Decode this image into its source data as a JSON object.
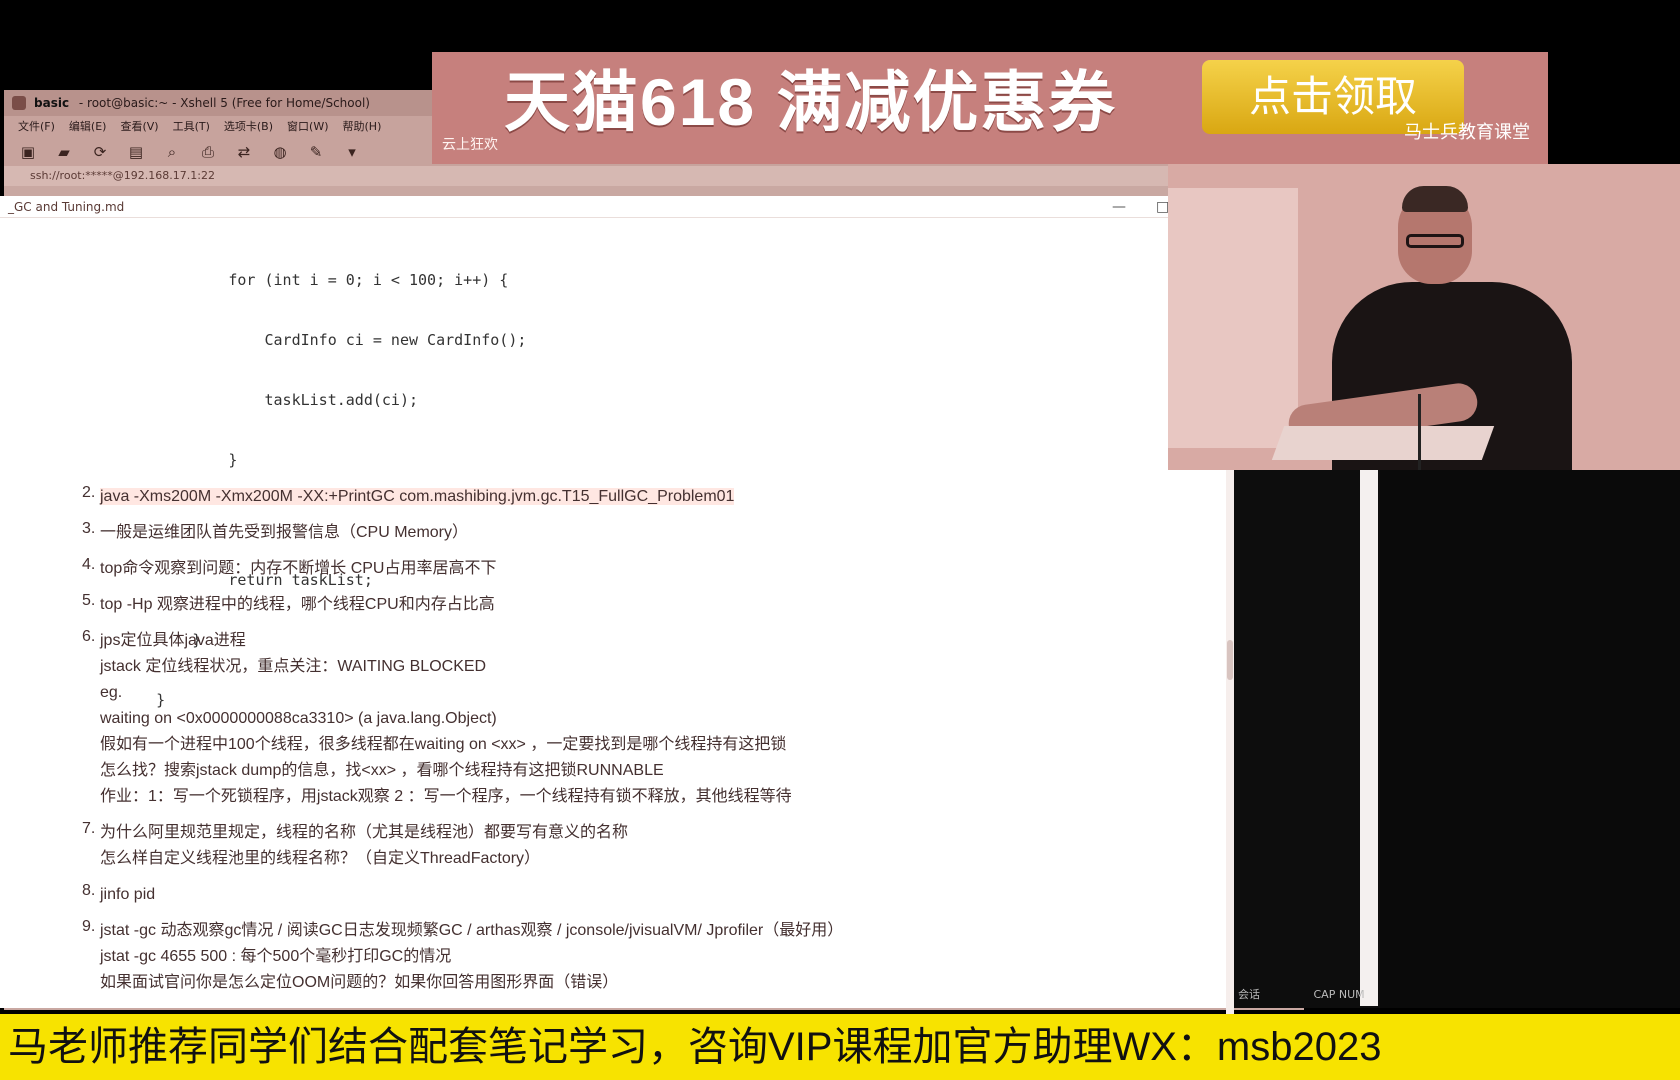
{
  "xshell": {
    "title_bold": "basic",
    "title_rest": "- root@basic:~ - Xshell 5 (Free for Home/School)",
    "menu": [
      "文件(F)",
      "编辑(E)",
      "查看(V)",
      "工具(T)",
      "选项卡(B)",
      "窗口(W)",
      "帮助(H)"
    ],
    "address": "ssh://root:*****@192.168.17.1:22",
    "toolbar_icons": [
      "new-session-icon",
      "open-folder-icon",
      "reconnect-icon",
      "properties-icon",
      "find-icon",
      "print-icon",
      "transfer-icon",
      "globe-icon",
      "script-icon",
      "more-icon"
    ]
  },
  "editor": {
    "file_title": "_GC and Tuning.md",
    "minimize": "—",
    "maximize": "□",
    "code_lines": [
      "            for (int i = 0; i < 100; i++) {",
      "                CardInfo ci = new CardInfo();",
      "                taskList.add(ci);",
      "            }",
      "",
      "            return taskList;",
      "        }",
      "    }"
    ],
    "items": [
      {
        "num": "2.",
        "lines": [
          "java -Xms200M -Xmx200M -XX:+PrintGC com.mashibing.jvm.gc.T15_FullGC_Problem01"
        ]
      },
      {
        "num": "3.",
        "lines": [
          "一般是运维团队首先受到报警信息（CPU Memory）"
        ]
      },
      {
        "num": "4.",
        "lines": [
          "top命令观察到问题：内存不断增长 CPU占用率居高不下"
        ]
      },
      {
        "num": "5.",
        "lines": [
          "top -Hp 观察进程中的线程，哪个线程CPU和内存占比高"
        ]
      },
      {
        "num": "6.",
        "lines": [
          "jps定位具体java进程",
          "jstack 定位线程状况，重点关注：WAITING BLOCKED",
          "eg.",
          "waiting on <0x0000000088ca3310> (a java.lang.Object)",
          "假如有一个进程中100个线程，很多线程都在waiting on <xx> ，一定要找到是哪个线程持有这把锁",
          "怎么找？搜索jstack dump的信息，找<xx> ，看哪个线程持有这把锁RUNNABLE",
          "作业：1：写一个死锁程序，用jstack观察 2 ：写一个程序，一个线程持有锁不释放，其他线程等待"
        ]
      },
      {
        "num": "7.",
        "lines": [
          "为什么阿里规范里规定，线程的名称（尤其是线程池）都要写有意义的名称",
          "怎么样自定义线程池里的线程名称？（自定义ThreadFactory）"
        ]
      },
      {
        "num": "8.",
        "lines": [
          "jinfo pid"
        ]
      },
      {
        "num": "9.",
        "lines": [
          "jstat -gc 动态观察gc情况 / 阅读GC日志发现频繁GC / arthas观察 / jconsole/jvisualVM/ Jprofiler（最好用）",
          "jstat -gc 4655 500 : 每个500个毫秒打印GC的情况",
          "如果面试官问你是怎么定位OOM问题的？如果你回答用图形界面（错误）"
        ]
      }
    ]
  },
  "status": {
    "left": "会话",
    "right": "CAP NUM"
  },
  "ad": {
    "main": "天猫618 满减优惠券",
    "button": "点击领取",
    "sub": "云上狂欢",
    "brand": "马士兵教育课堂"
  },
  "caption": "马老师推荐同学们结合配套笔记学习，咨询VIP课程加官方助理WX：msb2023",
  "colors": {
    "caption_bg": "#f7e300",
    "ad_bg": "#c6807d",
    "ad_button": "#e5bb23"
  }
}
